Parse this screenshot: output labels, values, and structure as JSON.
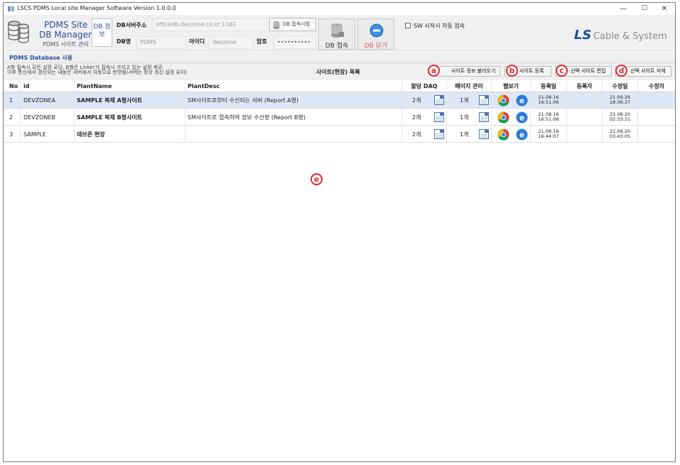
{
  "window": {
    "title": "LSCS PDMS Local site Manager Software Version 1.0.0.0",
    "min": "—",
    "max": "☐",
    "close": "✕"
  },
  "brand": {
    "line1": "PDMS Site",
    "line2": "DB Manager",
    "line3": "PDMS 사이트 관리",
    "dbinfo": "DB 정보"
  },
  "db": {
    "server_label": "DB서버주소",
    "server_value": "officedb.devzone.co.kr,1161",
    "name_label": "DB명",
    "name_value": "PDMS",
    "id_label": "아이디",
    "id_value": "devzone",
    "pw_label": "암호",
    "pw_value": "••••••••••",
    "test_button": "DB 접속시험",
    "connect_button": "DB 접속",
    "close_button": "DB 닫기",
    "autoconnect_label": "SW 시작시 자동 접속"
  },
  "logo": {
    "ls": "LS",
    "rest": "Cable & System"
  },
  "section_title": "PDMS Database 사용",
  "info": {
    "line1": "A형 접속시 모든 설정 로딩, B형은 Linker가 접속시 가지고 있는 설정 제공.",
    "line2": "이후 통신에서 갱신되는 내용은 서버에서 자동으로 반영됨(서버는 항상 최신 설정 유지)"
  },
  "list_title": "사이트(현장) 목록",
  "actions": [
    {
      "marker": "a",
      "label": "사이트 정보 불러오기"
    },
    {
      "marker": "b",
      "label": "사이트 등록"
    },
    {
      "marker": "c",
      "label": "선택 사이트 편집"
    },
    {
      "marker": "d",
      "label": "선택 사이트 삭제"
    }
  ],
  "area_marker": "e",
  "columns": [
    "No",
    "id",
    "PlantName",
    "PlantDesc",
    "할당 DAQ",
    "페이지 관리",
    "웹보기",
    "등록일",
    "등록자",
    "수정일",
    "수정자"
  ],
  "rows": [
    {
      "no": "1",
      "id": "DEVZONEA",
      "name": "SAMPLE 복제 A형사이트",
      "desc": "SM사이트로부터 수신되는 서버 (Report A형)",
      "daq": "2개",
      "pages": "1개",
      "reg1": "21.08.16",
      "reg2": "16:51:06",
      "mod1": "21.09.29",
      "mod2": "18:36:37",
      "selected": true
    },
    {
      "no": "2",
      "id": "DEVZONEB",
      "name": "SAMPLE 복제 B형사이트",
      "desc": "SM사이트로 접속하여 정보 수신형 (Report B형)",
      "daq": "2개",
      "pages": "1개",
      "reg1": "21.08.16",
      "reg2": "16:51:06",
      "mod1": "21.08.20",
      "mod2": "02:33:21",
      "selected": false
    },
    {
      "no": "3",
      "id": "SAMPLE",
      "name": "데브존 현장",
      "desc": "",
      "daq": "2개",
      "pages": "1개",
      "reg1": "21.08.16",
      "reg2": "16:44:07",
      "mod1": "21.08.20",
      "mod2": "03:43:05",
      "selected": false
    }
  ],
  "colors": {
    "accent": "#2a4e9c",
    "marker": "#e0272f",
    "selected_row": "#dde7f6"
  },
  "icons": {
    "db_stack": "database-stack-icon",
    "doc": "document-icon",
    "chrome": "chrome-icon",
    "edge": "edge-icon"
  }
}
